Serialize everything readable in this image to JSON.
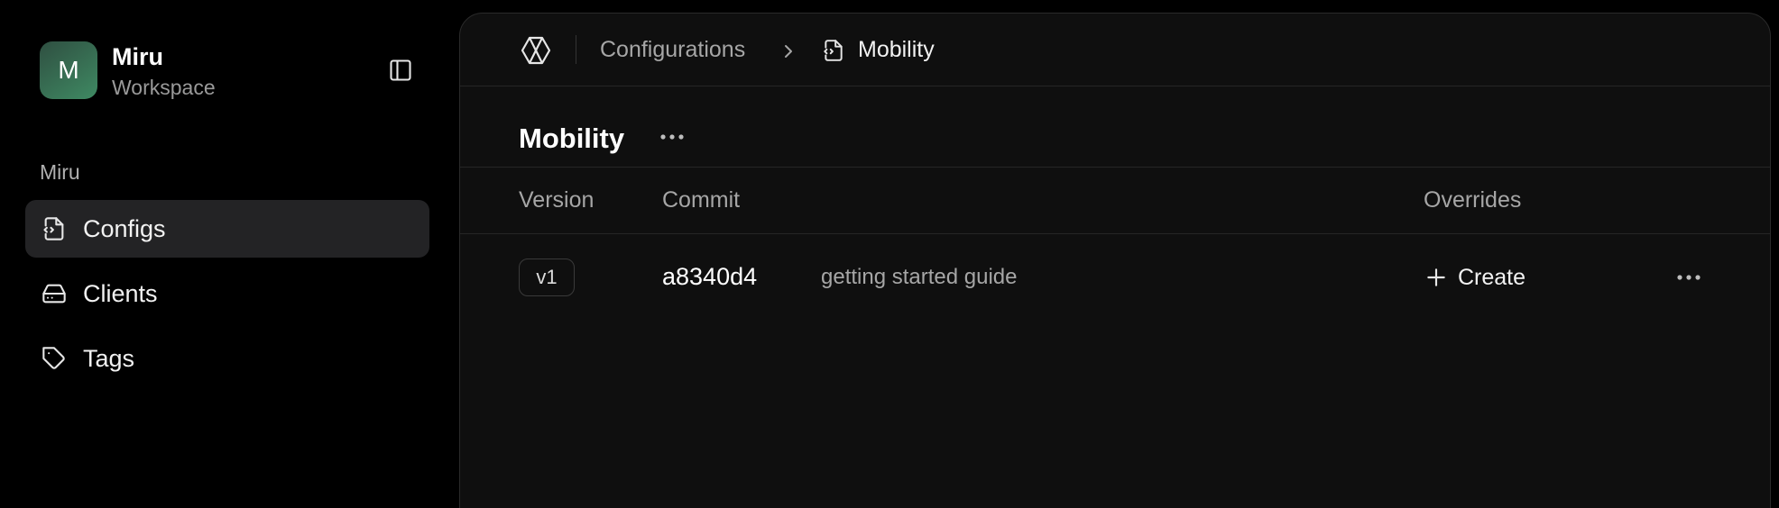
{
  "workspace": {
    "avatar_letter": "M",
    "name": "Miru",
    "subtitle": "Workspace"
  },
  "sidebar": {
    "section_label": "Miru",
    "items": [
      {
        "label": "Configs",
        "icon": "file-code-icon",
        "active": true
      },
      {
        "label": "Clients",
        "icon": "hard-drive-icon",
        "active": false
      },
      {
        "label": "Tags",
        "icon": "tag-icon",
        "active": false
      }
    ]
  },
  "breadcrumb": {
    "parent": "Configurations",
    "current": "Mobility"
  },
  "page": {
    "title": "Mobility"
  },
  "table": {
    "columns": {
      "version": "Version",
      "commit": "Commit",
      "overrides": "Overrides"
    },
    "rows": [
      {
        "version": "v1",
        "commit_hash": "a8340d4",
        "commit_message": "getting started guide",
        "overrides_action": "Create"
      }
    ]
  },
  "colors": {
    "background": "#000000",
    "panel": "#0f0f0f",
    "active_nav": "#232325",
    "avatar_gradient_start": "#2f4f41",
    "avatar_gradient_end": "#3f8a63",
    "muted_text": "#a6a6a6"
  }
}
